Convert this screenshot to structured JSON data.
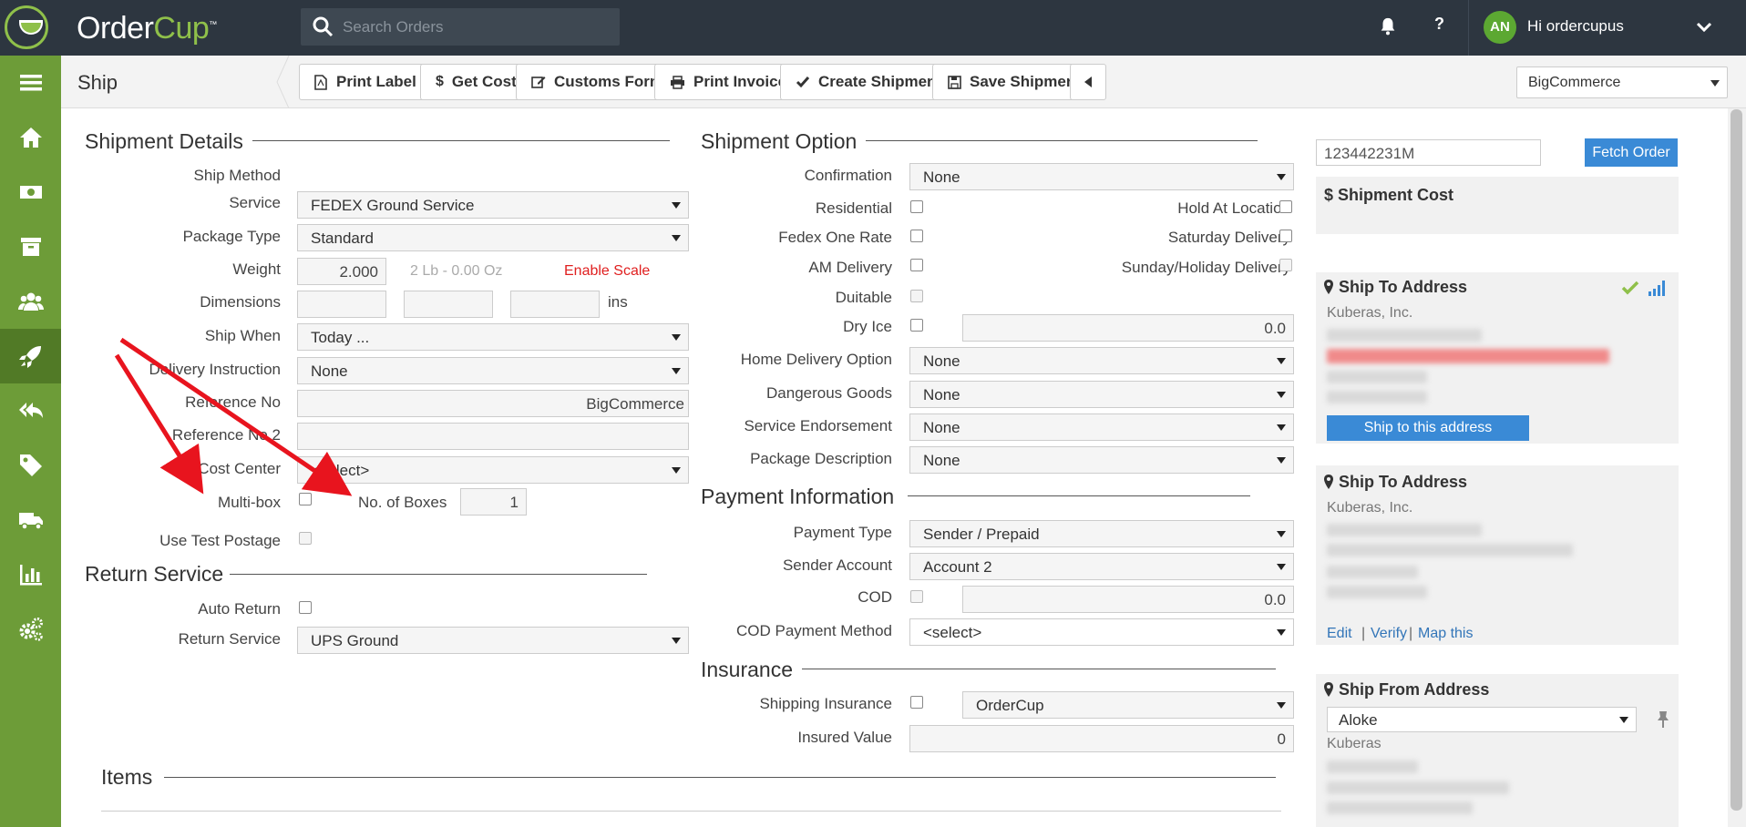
{
  "app": {
    "name_part1": "Order",
    "name_part2": "Cup",
    "tm": "™"
  },
  "search": {
    "placeholder": "Search Orders"
  },
  "header": {
    "help": "?",
    "avatar_initials": "AN",
    "greeting": "Hi ordercupus"
  },
  "sidebar": {
    "items": [
      "menu-icon",
      "home-icon",
      "money-icon",
      "archive-icon",
      "users-icon",
      "rocket-icon",
      "reply-all-icon",
      "tag-icon",
      "truck-icon",
      "bar-chart-icon",
      "gears-icon"
    ],
    "active_index": 5,
    "color": "#6d9c38"
  },
  "page": {
    "title": "Ship"
  },
  "toolbar": {
    "print_label": "Print Label",
    "get_cost": "Get Cost",
    "customs_form": "Customs Form",
    "print_invoice": "Print Invoice",
    "create_shipment": "Create Shipment",
    "save_shipment": "Save Shipment",
    "store": "BigCommerce"
  },
  "shipment_details": {
    "title": "Shipment Details",
    "ship_method_label": "Ship Method",
    "service_label": "Service",
    "service_value": "FEDEX Ground Service",
    "package_type_label": "Package Type",
    "package_type_value": "Standard",
    "weight_label": "Weight",
    "weight_value": "2.000",
    "weight_hint": "2 Lb - 0.00 Oz",
    "enable_scale": "Enable Scale",
    "dimensions_label": "Dimensions",
    "dimensions_unit": "ins",
    "ship_when_label": "Ship When",
    "ship_when_value": "Today ...",
    "delivery_instruction_label": "Delivery Instruction",
    "delivery_instruction_value": "None",
    "reference_no_label": "Reference No",
    "reference_no_value": "BigCommerce",
    "reference_no2_label": "Reference No 2",
    "cost_center_label": "Cost Center",
    "cost_center_value": "<select>",
    "multibox_label": "Multi-box",
    "no_of_boxes_label": "No. of Boxes",
    "no_of_boxes_value": "1",
    "use_test_postage_label": "Use Test Postage"
  },
  "return_service": {
    "title": "Return Service",
    "auto_return_label": "Auto Return",
    "return_service_label": "Return Service",
    "return_service_value": "UPS Ground"
  },
  "shipment_option": {
    "title": "Shipment Option",
    "confirmation_label": "Confirmation",
    "confirmation_value": "None",
    "residential_label": "Residential",
    "hold_at_location_label": "Hold At Location",
    "fedex_one_rate_label": "Fedex One Rate",
    "saturday_delivery_label": "Saturday Delivery",
    "am_delivery_label": "AM Delivery",
    "sunday_holiday_label": "Sunday/Holiday Delivery",
    "duitable_label": "Duitable",
    "dry_ice_label": "Dry Ice",
    "dry_ice_value": "0.0",
    "home_delivery_label": "Home Delivery Option",
    "home_delivery_value": "None",
    "dangerous_goods_label": "Dangerous Goods",
    "dangerous_goods_value": "None",
    "service_endorsement_label": "Service Endorsement",
    "service_endorsement_value": "None",
    "package_description_label": "Package Description",
    "package_description_value": "None"
  },
  "payment": {
    "title": "Payment Information",
    "payment_type_label": "Payment Type",
    "payment_type_value": "Sender / Prepaid",
    "sender_account_label": "Sender Account",
    "sender_account_value": "Account 2",
    "cod_label": "COD",
    "cod_value": "0.0",
    "cod_method_label": "COD Payment Method",
    "cod_method_value": "<select>"
  },
  "insurance": {
    "title": "Insurance",
    "shipping_insurance_label": "Shipping Insurance",
    "shipping_insurance_value": "OrderCup",
    "insured_value_label": "Insured Value",
    "insured_value_value": "0"
  },
  "items": {
    "title": "Items"
  },
  "right": {
    "order_no": "123442231M",
    "fetch_order": "Fetch Order",
    "shipment_cost_title": "$ Shipment Cost",
    "ship_to_title": "Ship To Address",
    "ship_to_company": "Kuberas, Inc.",
    "ship_to_this": "Ship to this address",
    "ship_to2_title": "Ship To Address",
    "ship_to2_company": "Kuberas, Inc.",
    "edit": "Edit",
    "verify": "Verify",
    "map_this": "Map this",
    "sep": "|",
    "ship_from_title": "Ship From Address",
    "ship_from_value": "Aloke",
    "ship_from_company": "Kuberas"
  },
  "colors": {
    "topbar": "#2d3640",
    "sidebar": "#6d9c38",
    "accent_green": "#8fc04a",
    "link_blue": "#3275b8",
    "button_blue": "#3a8ad6",
    "error_red": "#e02020"
  }
}
